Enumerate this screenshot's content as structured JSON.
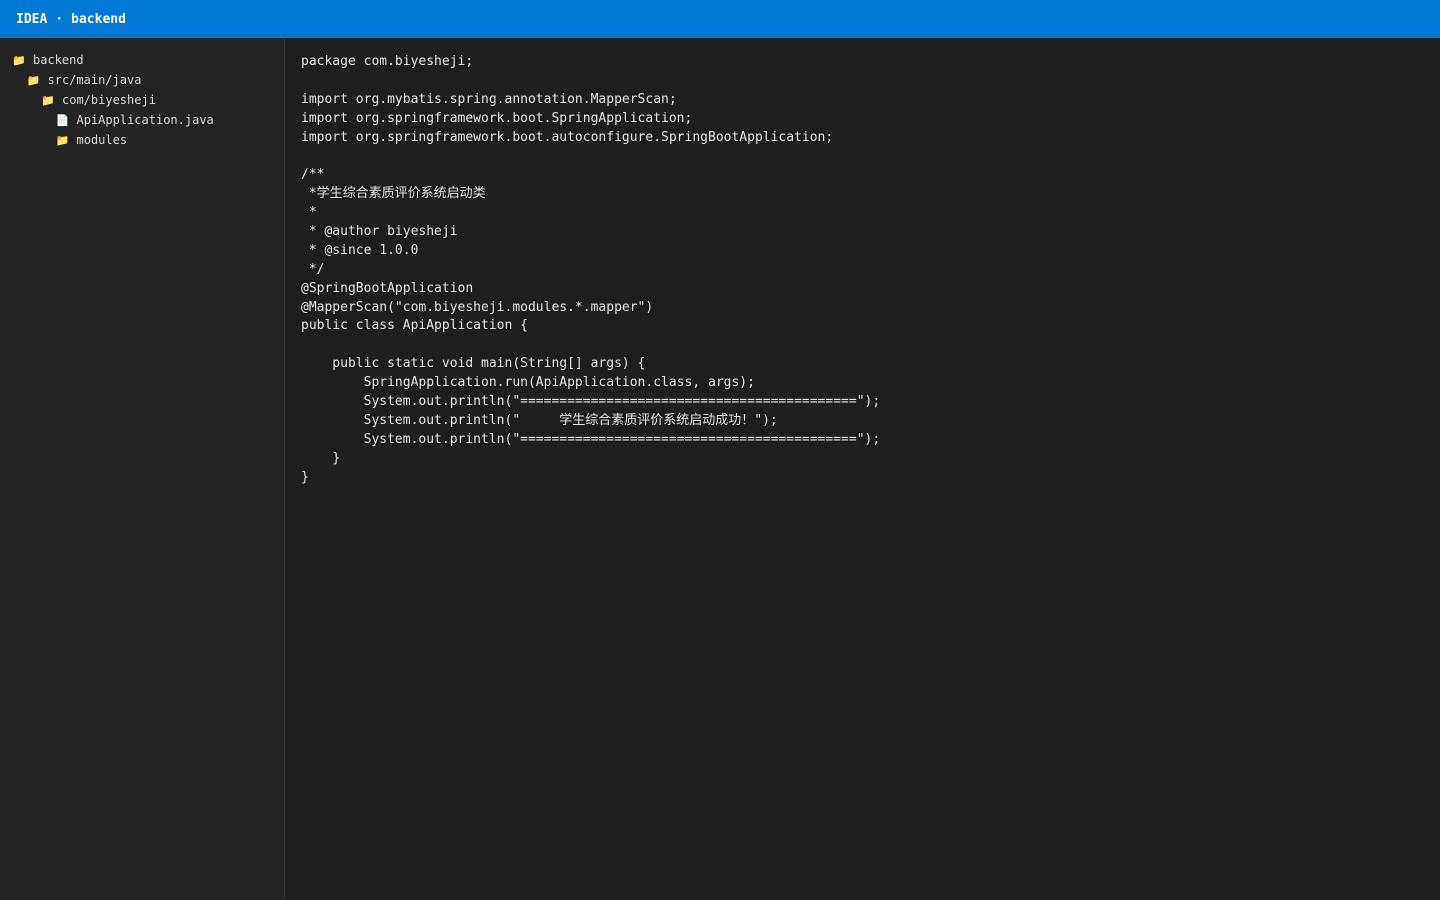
{
  "titlebar": {
    "app": "IDEA",
    "separator": "·",
    "project": "backend"
  },
  "sidebar": {
    "items": [
      {
        "label": "backend",
        "icon": "folder-icon",
        "depth": 0
      },
      {
        "label": "src/main/java",
        "icon": "folder-icon",
        "depth": 1
      },
      {
        "label": "com/biyesheji",
        "icon": "folder-icon",
        "depth": 2
      },
      {
        "label": "ApiApplication.java",
        "icon": "file-icon",
        "depth": 3
      },
      {
        "label": "modules",
        "icon": "folder-icon",
        "depth": 3
      }
    ]
  },
  "editor": {
    "lines": [
      "package com.biyesheji;",
      "",
      "import org.mybatis.spring.annotation.MapperScan;",
      "import org.springframework.boot.SpringApplication;",
      "import org.springframework.boot.autoconfigure.SpringBootApplication;",
      "",
      "/**",
      " *学生综合素质评价系统启动类",
      " *",
      " * @author biyesheji",
      " * @since 1.0.0",
      " */",
      "@SpringBootApplication",
      "@MapperScan(\"com.biyesheji.modules.*.mapper\")",
      "public class ApiApplication {",
      "",
      "    public static void main(String[] args) {",
      "        SpringApplication.run(ApiApplication.class, args);",
      "        System.out.println(\"===========================================\");",
      "        System.out.println(\"     学生综合素质评价系统启动成功！\");",
      "        System.out.println(\"===========================================\");",
      "    }",
      "}"
    ]
  },
  "colors": {
    "titlebar_bg": "#0078d4",
    "sidebar_bg": "#232323",
    "editor_bg": "#1e1e1e",
    "folder_icon": "#e8b339"
  }
}
